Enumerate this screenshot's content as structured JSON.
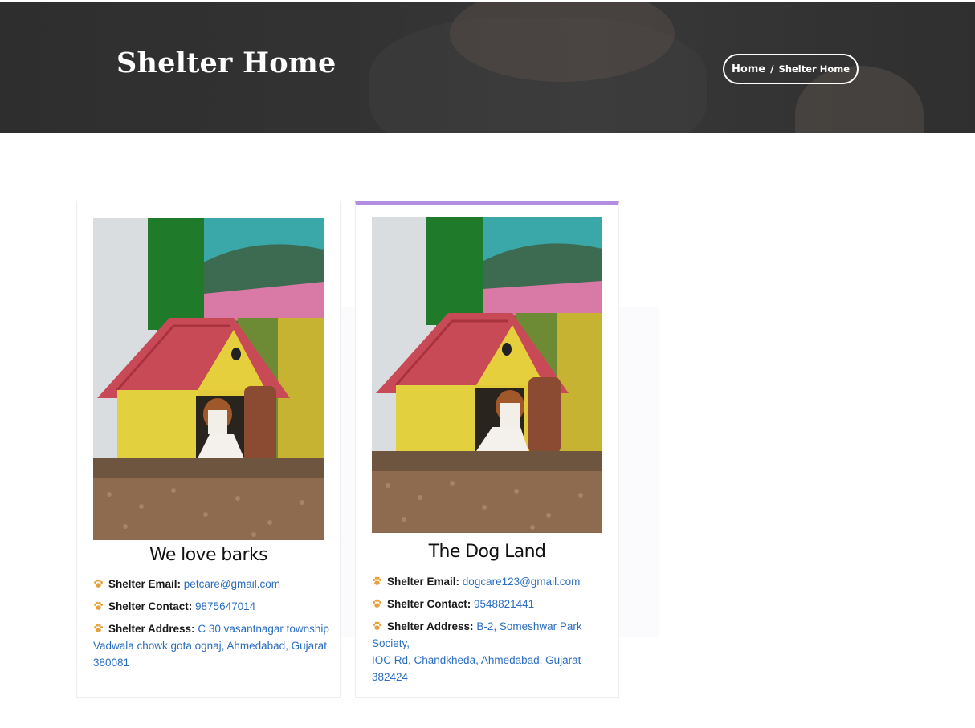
{
  "header": {
    "title": "Shelter Home",
    "breadcrumb": {
      "home": "Home",
      "separator": "/",
      "current": "Shelter Home"
    }
  },
  "shelters": [
    {
      "name": "We love barks",
      "email_label": "Shelter Email:",
      "email": "petcare@gmail.com",
      "contact_label": "Shelter Contact:",
      "contact": "9875647014",
      "address_label": "Shelter Address:",
      "address_line1": "C 30 vasantnagar township",
      "address_line2": "Vadwala chowk gota ognaj, Ahmedabad, Gujarat",
      "address_line3": "380081"
    },
    {
      "name": "The Dog Land",
      "email_label": "Shelter Email:",
      "email": "dogcare123@gmail.com",
      "contact_label": "Shelter Contact:",
      "contact": "9548821441",
      "address_label": "Shelter Address:",
      "address_line1": "B-2, Someshwar Park Society,",
      "address_line2": "IOC Rd, Chandkheda, Ahmedabad, Gujarat",
      "address_line3": "382424"
    }
  ],
  "colors": {
    "accent_top_border": "#b38ee0",
    "link": "#2a6dbf",
    "paw": "#e8a13a"
  },
  "icons": {
    "bullet": "paw-icon"
  }
}
